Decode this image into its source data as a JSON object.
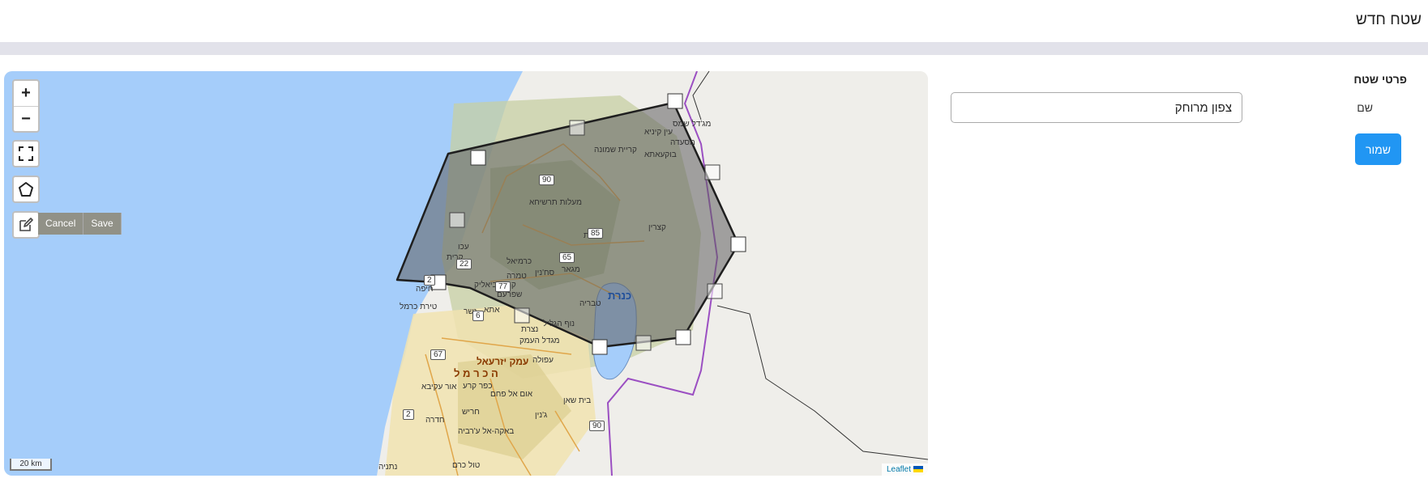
{
  "header": {
    "title": "שטח חדש"
  },
  "form": {
    "section_title": "פרטי שטח",
    "name_label": "שם",
    "name_value": "צפון מרוחק",
    "save_label": "שמור"
  },
  "map": {
    "zoom_in": "+",
    "zoom_out": "−",
    "edit_cancel": "Cancel",
    "edit_save": "Save",
    "scale_label": "20 km",
    "attribution": "Leaflet",
    "sea_label": "כנרת",
    "places": [
      "מג'דל שמס",
      "עין קיניא",
      "מסעדה",
      "בוקעאתא",
      "קריית שמונה",
      "מעלות תרשיחא",
      "צפת",
      "קצרין",
      "כרמיאל",
      "עכו",
      "סח'נין",
      "מגאר",
      "טמרה",
      "קרית ביאליק",
      "שפרעם",
      "טבריה",
      "קרית",
      "חיפה",
      "טירת כרמל",
      "נשר",
      "אתא",
      "נוף הגליל",
      "נצרת",
      "מגדל העמק",
      "עפולה",
      "עמק יזרעאל",
      "ה כ ר מ ל",
      "אום אל פחם",
      "בית שאן",
      "כפר קרע",
      "ג'נין",
      "חריש",
      "חדרה",
      "באקה-אל ע'רביה",
      "נתניה",
      "טול כרם",
      "אור עקיבא"
    ],
    "road_numbers": [
      "90",
      "85",
      "65",
      "22",
      "2",
      "77",
      "6",
      "67",
      "2",
      "90"
    ],
    "colors": {
      "sea": "#a5cdfa",
      "land": "#efeeea",
      "polygon_fill": "#5f5f5f",
      "polygon_stroke": "#1f1f1f",
      "border": "#9b4fc2"
    }
  }
}
